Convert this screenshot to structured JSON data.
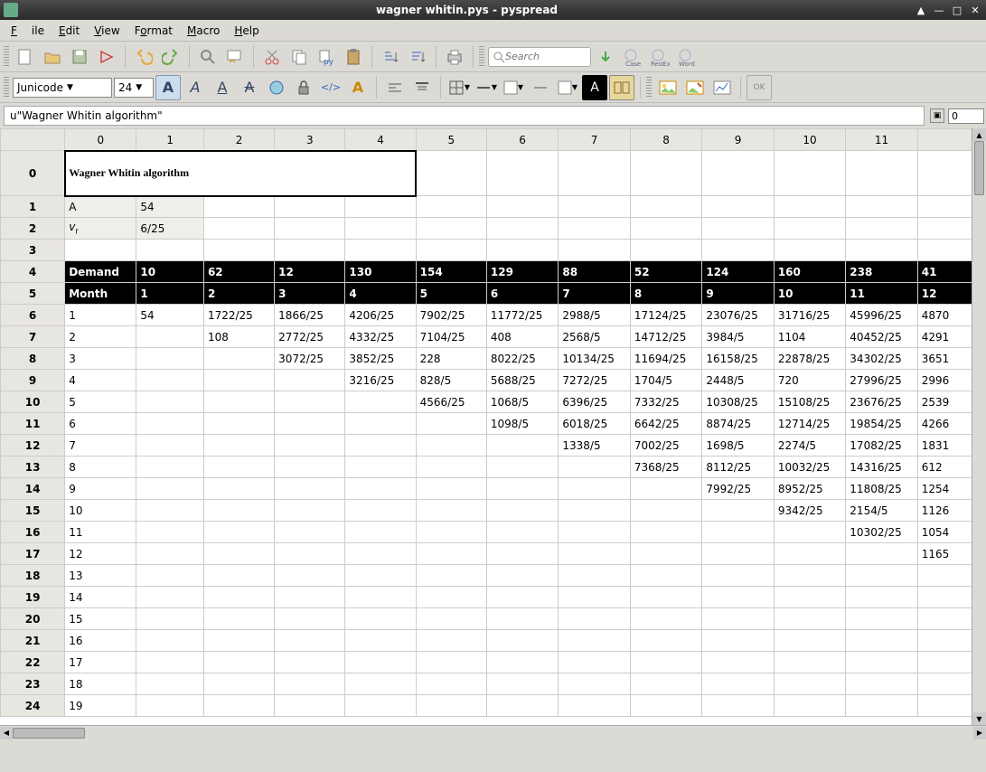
{
  "window": {
    "title": "wagner whitin.pys - pyspread"
  },
  "menu": {
    "file": "File",
    "edit": "Edit",
    "view": "View",
    "format": "Format",
    "macro": "Macro",
    "help": "Help"
  },
  "search": {
    "placeholder": "Search"
  },
  "font": {
    "name": "Junicode",
    "size": "24"
  },
  "formula": {
    "text": "u\"Wagner Whitin algorithm\"",
    "sheet": "0"
  },
  "columns": [
    "0",
    "1",
    "2",
    "3",
    "4",
    "5",
    "6",
    "7",
    "8",
    "9",
    "10",
    "11",
    ""
  ],
  "row_headers": [
    "0",
    "1",
    "2",
    "3",
    "4",
    "5",
    "6",
    "7",
    "8",
    "9",
    "10",
    "11",
    "12",
    "13",
    "14",
    "15",
    "16",
    "17",
    "18",
    "19",
    "20",
    "21",
    "22",
    "23",
    "24"
  ],
  "title_cell": "Wagner Whitin algorithm",
  "rows": {
    "r1": [
      "A",
      "54",
      "",
      "",
      "",
      "",
      "",
      "",
      "",
      "",
      "",
      "",
      ""
    ],
    "r2": [
      "vᵣ",
      "6/25",
      "",
      "",
      "",
      "",
      "",
      "",
      "",
      "",
      "",
      "",
      ""
    ],
    "r3": [
      "",
      "",
      "",
      "",
      "",
      "",
      "",
      "",
      "",
      "",
      "",
      "",
      ""
    ],
    "r4": [
      "Demand",
      "10",
      "62",
      "12",
      "130",
      "154",
      "129",
      "88",
      "52",
      "124",
      "160",
      "238",
      "41"
    ],
    "r5": [
      "Month",
      "1",
      "2",
      "3",
      "4",
      "5",
      "6",
      "7",
      "8",
      "9",
      "10",
      "11",
      "12"
    ],
    "r6": [
      "1",
      "54",
      "1722/25",
      "1866/25",
      "4206/25",
      "7902/25",
      "11772/25",
      "2988/5",
      "17124/25",
      "23076/25",
      "31716/25",
      "45996/25",
      "4870"
    ],
    "r7": [
      "2",
      "",
      "108",
      "2772/25",
      "4332/25",
      "7104/25",
      "408",
      "2568/5",
      "14712/25",
      "3984/5",
      "1104",
      "40452/25",
      "4291"
    ],
    "r8": [
      "3",
      "",
      "",
      "3072/25",
      "3852/25",
      "228",
      "8022/25",
      "10134/25",
      "11694/25",
      "16158/25",
      "22878/25",
      "34302/25",
      "3651"
    ],
    "r9": [
      "4",
      "",
      "",
      "",
      "3216/25",
      "828/5",
      "5688/25",
      "7272/25",
      "1704/5",
      "2448/5",
      "720",
      "27996/25",
      "2996"
    ],
    "r10": [
      "5",
      "",
      "",
      "",
      "",
      "4566/25",
      "1068/5",
      "6396/25",
      "7332/25",
      "10308/25",
      "15108/25",
      "23676/25",
      "2539"
    ],
    "r11": [
      "6",
      "",
      "",
      "",
      "",
      "",
      "1098/5",
      "6018/25",
      "6642/25",
      "8874/25",
      "12714/25",
      "19854/25",
      "4266"
    ],
    "r12": [
      "7",
      "",
      "",
      "",
      "",
      "",
      "",
      "1338/5",
      "7002/25",
      "1698/5",
      "2274/5",
      "17082/25",
      "1831"
    ],
    "r13": [
      "8",
      "",
      "",
      "",
      "",
      "",
      "",
      "",
      "7368/25",
      "8112/25",
      "10032/25",
      "14316/25",
      "612"
    ],
    "r14": [
      "9",
      "",
      "",
      "",
      "",
      "",
      "",
      "",
      "",
      "7992/25",
      "8952/25",
      "11808/25",
      "1254"
    ],
    "r15": [
      "10",
      "",
      "",
      "",
      "",
      "",
      "",
      "",
      "",
      "",
      "9342/25",
      "2154/5",
      "1126"
    ],
    "r16": [
      "11",
      "",
      "",
      "",
      "",
      "",
      "",
      "",
      "",
      "",
      "",
      "10302/25",
      "1054"
    ],
    "r17": [
      "12",
      "",
      "",
      "",
      "",
      "",
      "",
      "",
      "",
      "",
      "",
      "",
      "1165"
    ],
    "r18": [
      "13",
      "",
      "",
      "",
      "",
      "",
      "",
      "",
      "",
      "",
      "",
      "",
      ""
    ],
    "r19": [
      "14",
      "",
      "",
      "",
      "",
      "",
      "",
      "",
      "",
      "",
      "",
      "",
      ""
    ],
    "r20": [
      "15",
      "",
      "",
      "",
      "",
      "",
      "",
      "",
      "",
      "",
      "",
      "",
      ""
    ],
    "r21": [
      "16",
      "",
      "",
      "",
      "",
      "",
      "",
      "",
      "",
      "",
      "",
      "",
      ""
    ],
    "r22": [
      "17",
      "",
      "",
      "",
      "",
      "",
      "",
      "",
      "",
      "",
      "",
      "",
      ""
    ],
    "r23": [
      "18",
      "",
      "",
      "",
      "",
      "",
      "",
      "",
      "",
      "",
      "",
      "",
      ""
    ],
    "r24": [
      "19",
      "",
      "",
      "",
      "",
      "",
      "",
      "",
      "",
      "",
      "",
      "",
      ""
    ]
  }
}
